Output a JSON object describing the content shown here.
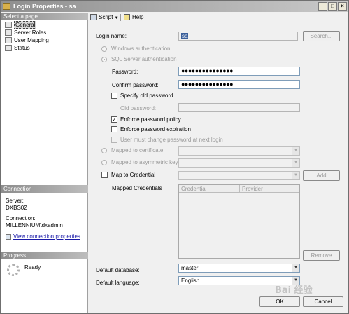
{
  "window": {
    "title": "Login Properties - sa"
  },
  "leftpanel": {
    "select_page_header": "Select a page",
    "pages": [
      {
        "label": "General",
        "selected": true
      },
      {
        "label": "Server Roles"
      },
      {
        "label": "User Mapping"
      },
      {
        "label": "Status"
      }
    ],
    "connection_header": "Connection",
    "server_label": "Server:",
    "server_value": "DXBS02",
    "connection_label": "Connection:",
    "connection_value": "MILLENNIUM\\dxadmin",
    "view_conn_link": "View connection properties",
    "progress_header": "Progress",
    "progress_status": "Ready"
  },
  "toolbar": {
    "script": "Script",
    "help": "Help"
  },
  "form": {
    "login_name_label": "Login name:",
    "login_name_value": "sa",
    "search_button": "Search...",
    "windows_auth": "Windows authentication",
    "sql_auth": "SQL Server authentication",
    "password_label": "Password:",
    "password_value": "●●●●●●●●●●●●●●●",
    "confirm_label": "Confirm password:",
    "confirm_value": "●●●●●●●●●●●●●●●",
    "specify_old": "Specify old password",
    "old_password_label": "Old password:",
    "enforce_policy": "Enforce password policy",
    "enforce_expiration": "Enforce password expiration",
    "must_change": "User must change password at next login",
    "mapped_cert": "Mapped to certificate",
    "mapped_asym": "Mapped to asymmetric key",
    "map_credential": "Map to Credential",
    "add_button": "Add",
    "mapped_credentials_label": "Mapped Credentials",
    "grid_headers": [
      "Credential",
      "Provider"
    ],
    "remove_button": "Remove",
    "default_db_label": "Default database:",
    "default_db_value": "master",
    "default_lang_label": "Default language:",
    "default_lang_value": "English"
  },
  "buttons": {
    "ok": "OK",
    "cancel": "Cancel"
  },
  "watermark": "Bai 经验"
}
